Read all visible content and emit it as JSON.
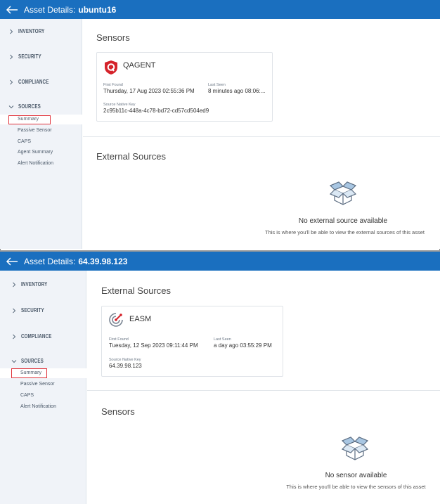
{
  "panel1": {
    "title_label": "Asset Details:",
    "asset_name": "ubuntu16",
    "sidebar": {
      "sections": [
        "INVENTORY",
        "SECURITY",
        "COMPLIANCE",
        "SOURCES"
      ],
      "sources_items": [
        "Summary",
        "Passive Sensor",
        "CAPS",
        "Agent Summary",
        "Alert Notification"
      ],
      "selected": "Summary"
    },
    "first_section_title": "Sensors",
    "card": {
      "icon": "qualys-shield-icon",
      "name": "QAGENT",
      "first_found_label": "First Found",
      "first_found_value": "Thursday, 17 Aug 2023 02:55:36 PM",
      "last_seen_label": "Last Seen",
      "last_seen_value": "8 minutes ago 08:06:...",
      "source_key_label": "Source Native Key",
      "source_key_value": "2c95b11c-448a-4c78-bd72-cd57cd504ed9"
    },
    "second_section_title": "External Sources",
    "empty": {
      "icon": "open-box-icon",
      "title": "No external source available",
      "subtitle": "This is where you'll be able to view the external sources of this asset"
    }
  },
  "panel2": {
    "title_label": "Asset Details:",
    "asset_name": "64.39.98.123",
    "sidebar": {
      "sections": [
        "INVENTORY",
        "SECURITY",
        "COMPLIANCE",
        "SOURCES"
      ],
      "sources_items": [
        "Summary",
        "Passive Sensor",
        "CAPS",
        "Alert Notification"
      ],
      "selected": "Summary"
    },
    "first_section_title": "External Sources",
    "card": {
      "icon": "easm-radar-icon",
      "name": "EASM",
      "first_found_label": "First Found",
      "first_found_value": "Tuesday, 12 Sep 2023 09:11:44 PM",
      "last_seen_label": "Last Seen",
      "last_seen_value": "a day ago 03:55:29 PM",
      "source_key_label": "Source Native Key",
      "source_key_value": "64.39.98.123"
    },
    "second_section_title": "Sensors",
    "empty": {
      "icon": "open-box-icon",
      "title": "No sensor available",
      "subtitle": "This is where you'll be able to view the sensors of this asset"
    }
  },
  "colors": {
    "titlebar": "#1a6fbf",
    "sidebar_bg": "#f0f3f8",
    "highlight_box": "#e0323a",
    "qualys_red": "#d5232b"
  }
}
